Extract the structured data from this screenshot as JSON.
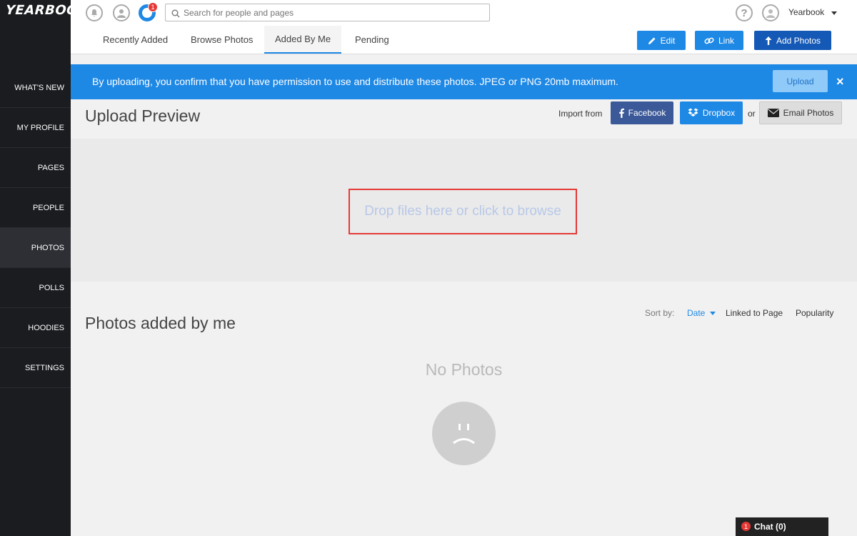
{
  "brand": {
    "logo_text": "YEARBOOK",
    "accent": "#1e88e5",
    "sidebar_bg": "#1b1c20"
  },
  "sidebar": {
    "items": [
      {
        "label": "WHAT'S NEW"
      },
      {
        "label": "MY PROFILE"
      },
      {
        "label": "PAGES"
      },
      {
        "label": "PEOPLE"
      },
      {
        "label": "PHOTOS",
        "active": true
      },
      {
        "label": "POLLS"
      },
      {
        "label": "HOODIES"
      },
      {
        "label": "SETTINGS"
      }
    ]
  },
  "header": {
    "notification_count": "1",
    "search_placeholder": "Search for people and pages",
    "help_icon_glyph": "?",
    "username": "Yearbook"
  },
  "tabs": [
    {
      "label": "Recently Added"
    },
    {
      "label": "Browse Photos"
    },
    {
      "label": "Added By Me",
      "active": true
    },
    {
      "label": "Pending"
    }
  ],
  "actions": {
    "edit": "Edit",
    "link": "Link",
    "add_photos": "Add Photos"
  },
  "banner": {
    "text": "By uploading, you confirm that you have permission to use and distribute these photos. JPEG or PNG 20mb maximum.",
    "upload_label": "Upload",
    "close_glyph": "×"
  },
  "upload_preview": {
    "title": "Upload Preview",
    "import_label": "Import from",
    "facebook": "Facebook",
    "dropbox": "Dropbox",
    "or": "or",
    "email": "Email Photos",
    "drop_text": "Drop files here or click to browse"
  },
  "photos_section": {
    "title": "Photos added by me",
    "sort_label": "Sort by:",
    "sort_date": "Date",
    "sort_linked": "Linked to Page",
    "sort_popularity": "Popularity",
    "empty_text": "No Photos"
  },
  "chat": {
    "label": "Chat (0)",
    "badge": "1"
  }
}
